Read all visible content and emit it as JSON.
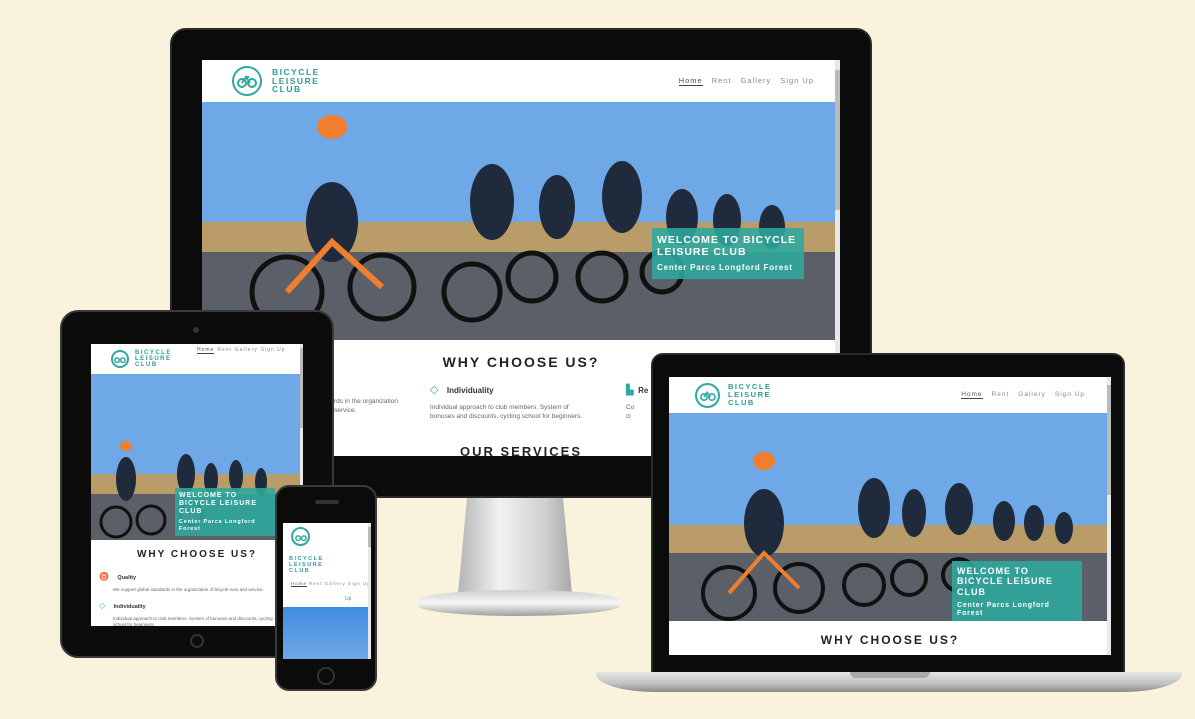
{
  "site": {
    "logo_text": [
      "BICYCLE",
      "LEISURE",
      "CLUB"
    ],
    "nav": [
      "Home",
      "Rent",
      "Gallery",
      "Sign Up"
    ],
    "hero_title": "WELCOME TO BICYCLE LEISURE CLUB",
    "hero_subtitle": "Center Parcs Longford Forest",
    "why_title": "WHY CHOOSE US?",
    "services_title": "OUR SERVICES",
    "features": [
      {
        "icon": "medal-icon",
        "title": "Quality",
        "text": "We support global standards in the organization of bicycle runs and service."
      },
      {
        "icon": "diamond-icon",
        "title": "Individuality",
        "text": "Individual approach to club members. System of bonuses and discounts, cycling school for beginners."
      },
      {
        "icon": "podium-icon",
        "title": "Re"
      }
    ],
    "partial_texts": {
      "desktop_left_line1": "rds in the organization",
      "desktop_left_line2": "service.",
      "desktop_right_line1": "Co",
      "desktop_right_line2": "cl",
      "phone_partial_item": "Up"
    }
  },
  "colors": {
    "background": "#f9f3dd",
    "accent": "#2fa8a0",
    "sky": "#6fa8e6",
    "device_black": "#0d0d0d"
  }
}
